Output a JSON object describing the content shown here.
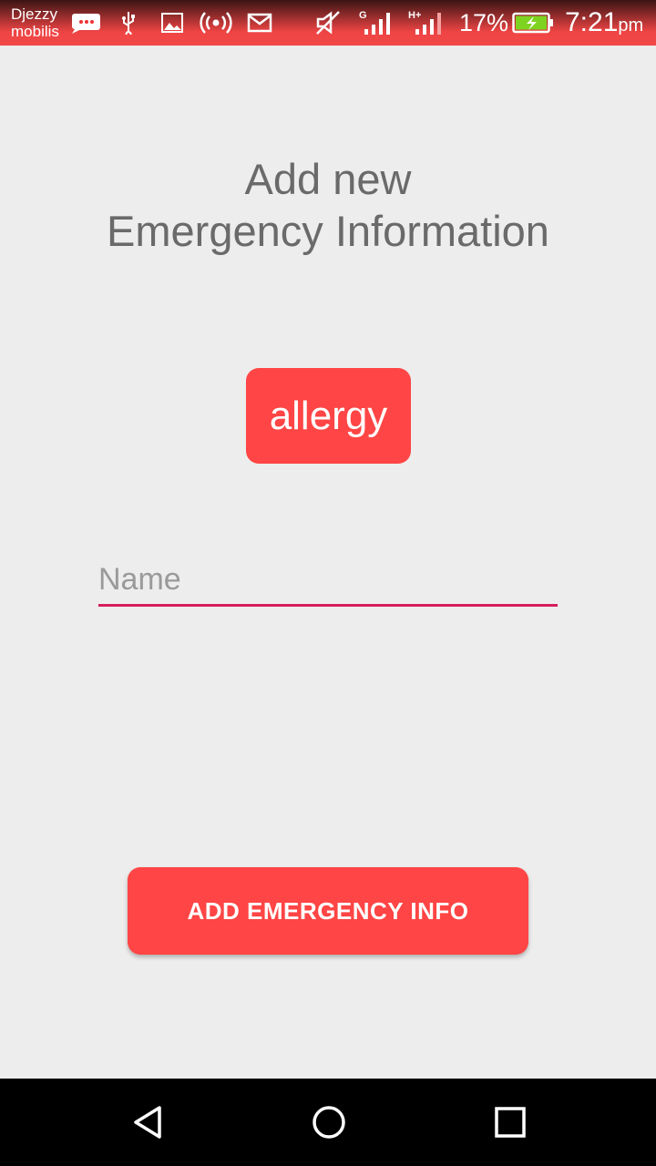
{
  "status_bar": {
    "carrier_line1": "Djezzy",
    "carrier_line2": "mobilis",
    "battery_percent": "17%",
    "time": "7:21",
    "time_suffix": "pm",
    "network_label_g": "G",
    "network_label_h": "H+",
    "icons": [
      "message-icon",
      "usb-icon",
      "image-icon",
      "hotspot-icon",
      "mail-icon",
      "mute-icon",
      "signal-icon",
      "signal-icon",
      "battery-charging-icon"
    ],
    "battery_color": "#7ed321"
  },
  "page": {
    "title_line1": "Add new",
    "title_line2": "Emergency Information",
    "category_chip": "allergy",
    "name_placeholder": "Name",
    "name_value": "",
    "add_button_label": "ADD EMERGENCY INFO"
  },
  "colors": {
    "accent": "#ff4545",
    "field_underline": "#d61f5c",
    "background": "#ededed",
    "title_text": "#6a6a6a"
  },
  "nav_bar": {
    "buttons": [
      "back-icon",
      "home-icon",
      "recents-icon"
    ]
  }
}
